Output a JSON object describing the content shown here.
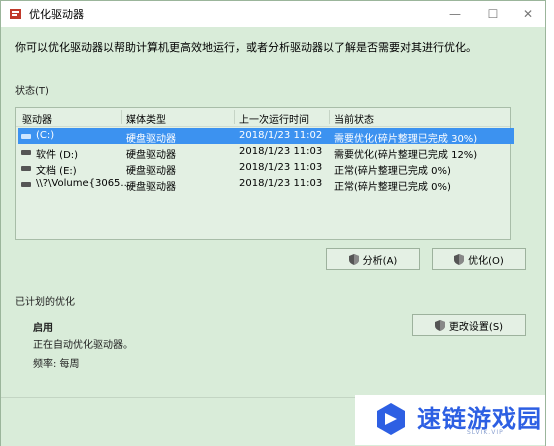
{
  "window": {
    "title": "优化驱动器"
  },
  "description": "你可以优化驱动器以帮助计算机更高效地运行，或者分析驱动器以了解是否需要对其进行优化。",
  "status_section": {
    "label": "状态(T)",
    "columns": [
      "驱动器",
      "媒体类型",
      "上一次运行时间",
      "当前状态"
    ],
    "rows": [
      {
        "drive": "(C:)",
        "media": "硬盘驱动器",
        "last_run": "2018/1/23 11:02",
        "status": "需要优化(碎片整理已完成 30%)",
        "selected": true
      },
      {
        "drive": "软件 (D:)",
        "media": "硬盘驱动器",
        "last_run": "2018/1/23 11:03",
        "status": "需要优化(碎片整理已完成 12%)",
        "selected": false
      },
      {
        "drive": "文档 (E:)",
        "media": "硬盘驱动器",
        "last_run": "2018/1/23 11:03",
        "status": "正常(碎片整理已完成 0%)",
        "selected": false
      },
      {
        "drive": "\\\\?\\Volume{3065...",
        "media": "硬盘驱动器",
        "last_run": "2018/1/23 11:03",
        "status": "正常(碎片整理已完成 0%)",
        "selected": false
      }
    ]
  },
  "buttons": {
    "analyze": "分析(A)",
    "optimize": "优化(O)",
    "change_settings": "更改设置(S)"
  },
  "scheduled": {
    "label": "已计划的优化",
    "state": "启用",
    "desc": "正在自动优化驱动器。",
    "frequency": "频率: 每周"
  },
  "watermark": {
    "text": "速链游戏园",
    "sub": "SLVIK.VIP"
  },
  "colors": {
    "window_bg": "#d9ecd9",
    "selection": "#3c92f0",
    "watermark_blue": "#2d5fe3"
  }
}
